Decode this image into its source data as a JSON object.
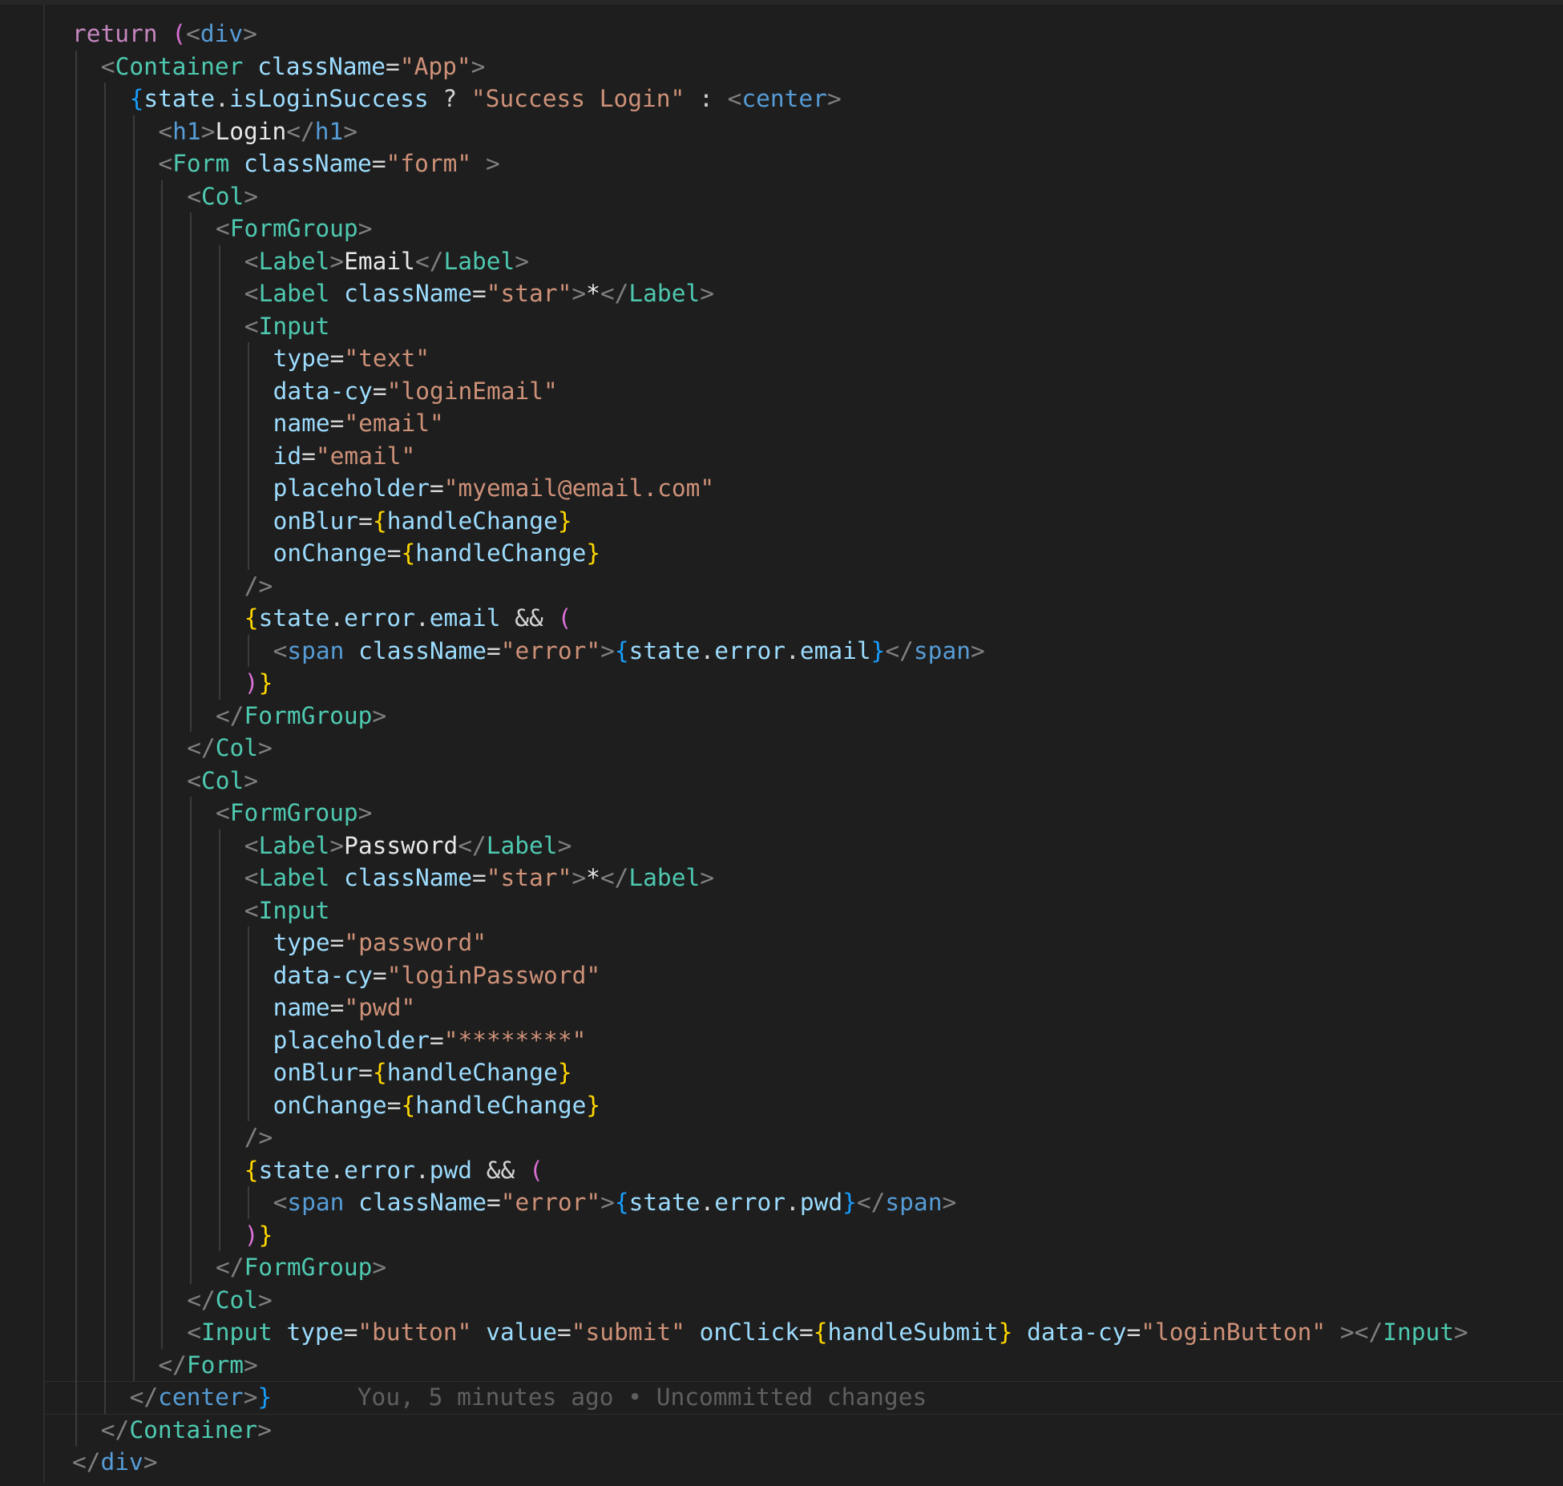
{
  "editor": {
    "blame": "You, 5 minutes ago • Uncommitted changes",
    "current_line_index": 42,
    "lines": [
      {
        "indent": 0,
        "tokens": [
          [
            "k",
            "return"
          ],
          [
            "o",
            " "
          ],
          [
            "b2",
            "("
          ],
          [
            "p",
            "<"
          ],
          [
            "h",
            "div"
          ],
          [
            "p",
            ">"
          ]
        ]
      },
      {
        "indent": 1,
        "tokens": [
          [
            "p",
            "<"
          ],
          [
            "t",
            "Container"
          ],
          [
            "o",
            " "
          ],
          [
            "a",
            "className"
          ],
          [
            "o",
            "="
          ],
          [
            "s",
            "\"App\""
          ],
          [
            "p",
            ">"
          ]
        ]
      },
      {
        "indent": 2,
        "tokens": [
          [
            "b3",
            "{"
          ],
          [
            "v",
            "state"
          ],
          [
            "o",
            "."
          ],
          [
            "v",
            "isLoginSuccess"
          ],
          [
            "o",
            " ? "
          ],
          [
            "s",
            "\"Success Login\""
          ],
          [
            "o",
            " : "
          ],
          [
            "p",
            "<"
          ],
          [
            "h",
            "center"
          ],
          [
            "p",
            ">"
          ]
        ]
      },
      {
        "indent": 3,
        "tokens": [
          [
            "p",
            "<"
          ],
          [
            "h",
            "h1"
          ],
          [
            "p",
            ">"
          ],
          [
            "x",
            "Login"
          ],
          [
            "p",
            "</"
          ],
          [
            "h",
            "h1"
          ],
          [
            "p",
            ">"
          ]
        ]
      },
      {
        "indent": 3,
        "tokens": [
          [
            "p",
            "<"
          ],
          [
            "t",
            "Form"
          ],
          [
            "o",
            " "
          ],
          [
            "a",
            "className"
          ],
          [
            "o",
            "="
          ],
          [
            "s",
            "\"form\""
          ],
          [
            "o",
            " "
          ],
          [
            "p",
            ">"
          ]
        ]
      },
      {
        "indent": 4,
        "tokens": [
          [
            "p",
            "<"
          ],
          [
            "t",
            "Col"
          ],
          [
            "p",
            ">"
          ]
        ]
      },
      {
        "indent": 5,
        "tokens": [
          [
            "p",
            "<"
          ],
          [
            "t",
            "FormGroup"
          ],
          [
            "p",
            ">"
          ]
        ]
      },
      {
        "indent": 6,
        "tokens": [
          [
            "p",
            "<"
          ],
          [
            "t",
            "Label"
          ],
          [
            "p",
            ">"
          ],
          [
            "x",
            "Email"
          ],
          [
            "p",
            "</"
          ],
          [
            "t",
            "Label"
          ],
          [
            "p",
            ">"
          ]
        ]
      },
      {
        "indent": 6,
        "tokens": [
          [
            "p",
            "<"
          ],
          [
            "t",
            "Label"
          ],
          [
            "o",
            " "
          ],
          [
            "a",
            "className"
          ],
          [
            "o",
            "="
          ],
          [
            "s",
            "\"star\""
          ],
          [
            "p",
            ">"
          ],
          [
            "x",
            "*"
          ],
          [
            "p",
            "</"
          ],
          [
            "t",
            "Label"
          ],
          [
            "p",
            ">"
          ]
        ]
      },
      {
        "indent": 6,
        "tokens": [
          [
            "p",
            "<"
          ],
          [
            "t",
            "Input"
          ]
        ]
      },
      {
        "indent": 7,
        "tokens": [
          [
            "a",
            "type"
          ],
          [
            "o",
            "="
          ],
          [
            "s",
            "\"text\""
          ]
        ]
      },
      {
        "indent": 7,
        "tokens": [
          [
            "a",
            "data-cy"
          ],
          [
            "o",
            "="
          ],
          [
            "s",
            "\"loginEmail\""
          ]
        ]
      },
      {
        "indent": 7,
        "tokens": [
          [
            "a",
            "name"
          ],
          [
            "o",
            "="
          ],
          [
            "s",
            "\"email\""
          ]
        ]
      },
      {
        "indent": 7,
        "tokens": [
          [
            "a",
            "id"
          ],
          [
            "o",
            "="
          ],
          [
            "s",
            "\"email\""
          ]
        ]
      },
      {
        "indent": 7,
        "tokens": [
          [
            "a",
            "placeholder"
          ],
          [
            "o",
            "="
          ],
          [
            "s",
            "\"myemail@email.com\""
          ]
        ]
      },
      {
        "indent": 7,
        "tokens": [
          [
            "a",
            "onBlur"
          ],
          [
            "o",
            "="
          ],
          [
            "b1",
            "{"
          ],
          [
            "v",
            "handleChange"
          ],
          [
            "b1",
            "}"
          ]
        ]
      },
      {
        "indent": 7,
        "tokens": [
          [
            "a",
            "onChange"
          ],
          [
            "o",
            "="
          ],
          [
            "b1",
            "{"
          ],
          [
            "v",
            "handleChange"
          ],
          [
            "b1",
            "}"
          ]
        ]
      },
      {
        "indent": 6,
        "tokens": [
          [
            "p",
            "/>"
          ]
        ]
      },
      {
        "indent": 6,
        "tokens": [
          [
            "b1",
            "{"
          ],
          [
            "v",
            "state"
          ],
          [
            "o",
            "."
          ],
          [
            "v",
            "error"
          ],
          [
            "o",
            "."
          ],
          [
            "v",
            "email"
          ],
          [
            "o",
            " && "
          ],
          [
            "b2",
            "("
          ]
        ]
      },
      {
        "indent": 7,
        "tokens": [
          [
            "p",
            "<"
          ],
          [
            "h",
            "span"
          ],
          [
            "o",
            " "
          ],
          [
            "a",
            "className"
          ],
          [
            "o",
            "="
          ],
          [
            "s",
            "\"error\""
          ],
          [
            "p",
            ">"
          ],
          [
            "b3",
            "{"
          ],
          [
            "v",
            "state"
          ],
          [
            "o",
            "."
          ],
          [
            "v",
            "error"
          ],
          [
            "o",
            "."
          ],
          [
            "v",
            "email"
          ],
          [
            "b3",
            "}"
          ],
          [
            "p",
            "</"
          ],
          [
            "h",
            "span"
          ],
          [
            "p",
            ">"
          ]
        ]
      },
      {
        "indent": 6,
        "tokens": [
          [
            "b2",
            ")"
          ],
          [
            "b1",
            "}"
          ]
        ]
      },
      {
        "indent": 5,
        "tokens": [
          [
            "p",
            "</"
          ],
          [
            "t",
            "FormGroup"
          ],
          [
            "p",
            ">"
          ]
        ]
      },
      {
        "indent": 4,
        "tokens": [
          [
            "p",
            "</"
          ],
          [
            "t",
            "Col"
          ],
          [
            "p",
            ">"
          ]
        ]
      },
      {
        "indent": 4,
        "tokens": [
          [
            "p",
            "<"
          ],
          [
            "t",
            "Col"
          ],
          [
            "p",
            ">"
          ]
        ]
      },
      {
        "indent": 5,
        "tokens": [
          [
            "p",
            "<"
          ],
          [
            "t",
            "FormGroup"
          ],
          [
            "p",
            ">"
          ]
        ]
      },
      {
        "indent": 6,
        "tokens": [
          [
            "p",
            "<"
          ],
          [
            "t",
            "Label"
          ],
          [
            "p",
            ">"
          ],
          [
            "x",
            "Password"
          ],
          [
            "p",
            "</"
          ],
          [
            "t",
            "Label"
          ],
          [
            "p",
            ">"
          ]
        ]
      },
      {
        "indent": 6,
        "tokens": [
          [
            "p",
            "<"
          ],
          [
            "t",
            "Label"
          ],
          [
            "o",
            " "
          ],
          [
            "a",
            "className"
          ],
          [
            "o",
            "="
          ],
          [
            "s",
            "\"star\""
          ],
          [
            "p",
            ">"
          ],
          [
            "x",
            "*"
          ],
          [
            "p",
            "</"
          ],
          [
            "t",
            "Label"
          ],
          [
            "p",
            ">"
          ]
        ]
      },
      {
        "indent": 6,
        "tokens": [
          [
            "p",
            "<"
          ],
          [
            "t",
            "Input"
          ]
        ]
      },
      {
        "indent": 7,
        "tokens": [
          [
            "a",
            "type"
          ],
          [
            "o",
            "="
          ],
          [
            "s",
            "\"password\""
          ]
        ]
      },
      {
        "indent": 7,
        "tokens": [
          [
            "a",
            "data-cy"
          ],
          [
            "o",
            "="
          ],
          [
            "s",
            "\"loginPassword\""
          ]
        ]
      },
      {
        "indent": 7,
        "tokens": [
          [
            "a",
            "name"
          ],
          [
            "o",
            "="
          ],
          [
            "s",
            "\"pwd\""
          ]
        ]
      },
      {
        "indent": 7,
        "tokens": [
          [
            "a",
            "placeholder"
          ],
          [
            "o",
            "="
          ],
          [
            "s",
            "\"********\""
          ]
        ]
      },
      {
        "indent": 7,
        "tokens": [
          [
            "a",
            "onBlur"
          ],
          [
            "o",
            "="
          ],
          [
            "b1",
            "{"
          ],
          [
            "v",
            "handleChange"
          ],
          [
            "b1",
            "}"
          ]
        ]
      },
      {
        "indent": 7,
        "tokens": [
          [
            "a",
            "onChange"
          ],
          [
            "o",
            "="
          ],
          [
            "b1",
            "{"
          ],
          [
            "v",
            "handleChange"
          ],
          [
            "b1",
            "}"
          ]
        ]
      },
      {
        "indent": 6,
        "tokens": [
          [
            "p",
            "/>"
          ]
        ]
      },
      {
        "indent": 6,
        "tokens": [
          [
            "b1",
            "{"
          ],
          [
            "v",
            "state"
          ],
          [
            "o",
            "."
          ],
          [
            "v",
            "error"
          ],
          [
            "o",
            "."
          ],
          [
            "v",
            "pwd"
          ],
          [
            "o",
            " && "
          ],
          [
            "b2",
            "("
          ]
        ]
      },
      {
        "indent": 7,
        "tokens": [
          [
            "p",
            "<"
          ],
          [
            "h",
            "span"
          ],
          [
            "o",
            " "
          ],
          [
            "a",
            "className"
          ],
          [
            "o",
            "="
          ],
          [
            "s",
            "\"error\""
          ],
          [
            "p",
            ">"
          ],
          [
            "b3",
            "{"
          ],
          [
            "v",
            "state"
          ],
          [
            "o",
            "."
          ],
          [
            "v",
            "error"
          ],
          [
            "o",
            "."
          ],
          [
            "v",
            "pwd"
          ],
          [
            "b3",
            "}"
          ],
          [
            "p",
            "</"
          ],
          [
            "h",
            "span"
          ],
          [
            "p",
            ">"
          ]
        ]
      },
      {
        "indent": 6,
        "tokens": [
          [
            "b2",
            ")"
          ],
          [
            "b1",
            "}"
          ]
        ]
      },
      {
        "indent": 5,
        "tokens": [
          [
            "p",
            "</"
          ],
          [
            "t",
            "FormGroup"
          ],
          [
            "p",
            ">"
          ]
        ]
      },
      {
        "indent": 4,
        "tokens": [
          [
            "p",
            "</"
          ],
          [
            "t",
            "Col"
          ],
          [
            "p",
            ">"
          ]
        ]
      },
      {
        "indent": 4,
        "tokens": [
          [
            "p",
            "<"
          ],
          [
            "t",
            "Input"
          ],
          [
            "o",
            " "
          ],
          [
            "a",
            "type"
          ],
          [
            "o",
            "="
          ],
          [
            "s",
            "\"button\""
          ],
          [
            "o",
            " "
          ],
          [
            "a",
            "value"
          ],
          [
            "o",
            "="
          ],
          [
            "s",
            "\"submit\""
          ],
          [
            "o",
            " "
          ],
          [
            "a",
            "onClick"
          ],
          [
            "o",
            "="
          ],
          [
            "b1",
            "{"
          ],
          [
            "v",
            "handleSubmit"
          ],
          [
            "b1",
            "}"
          ],
          [
            "o",
            " "
          ],
          [
            "a",
            "data-cy"
          ],
          [
            "o",
            "="
          ],
          [
            "s",
            "\"loginButton\""
          ],
          [
            "o",
            " "
          ],
          [
            "p",
            "></"
          ],
          [
            "t",
            "Input"
          ],
          [
            "p",
            ">"
          ]
        ]
      },
      {
        "indent": 3,
        "tokens": [
          [
            "p",
            "</"
          ],
          [
            "t",
            "Form"
          ],
          [
            "p",
            ">"
          ]
        ]
      },
      {
        "indent": 2,
        "tokens": [
          [
            "p",
            "</"
          ],
          [
            "h",
            "center"
          ],
          [
            "p",
            ">"
          ],
          [
            "b3",
            "}"
          ]
        ]
      },
      {
        "indent": 1,
        "tokens": [
          [
            "p",
            "</"
          ],
          [
            "t",
            "Container"
          ],
          [
            "p",
            ">"
          ]
        ]
      },
      {
        "indent": 0,
        "tokens": [
          [
            "p",
            "</"
          ],
          [
            "h",
            "div"
          ],
          [
            "p",
            ">"
          ]
        ]
      }
    ]
  }
}
